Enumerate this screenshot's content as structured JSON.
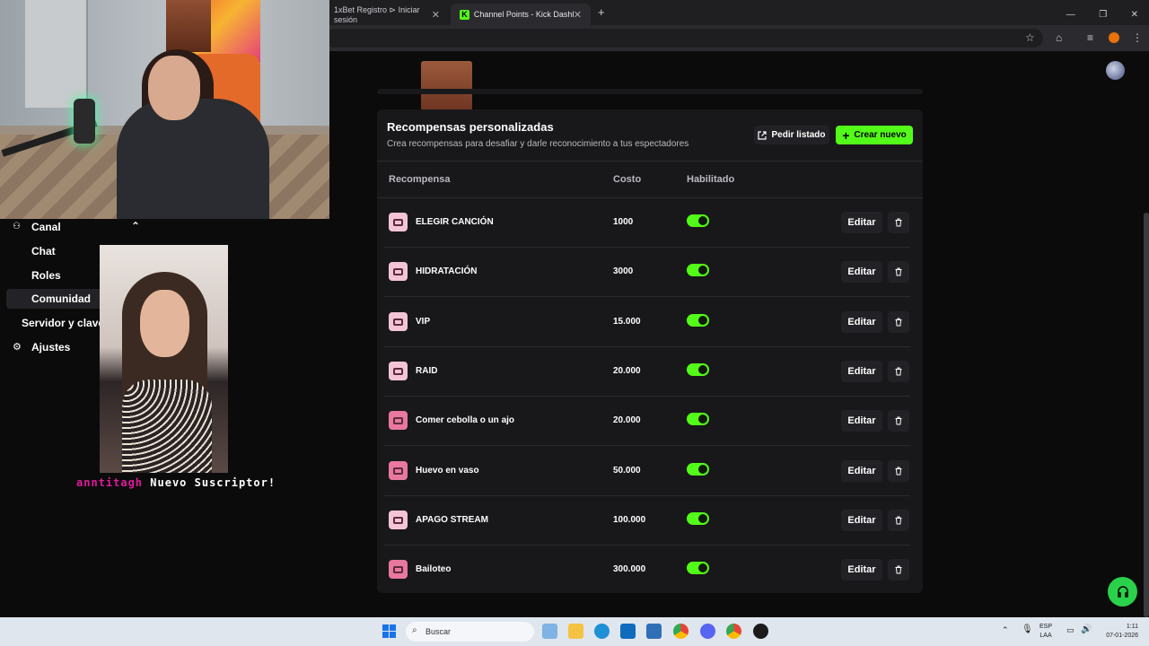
{
  "browser": {
    "tabs": [
      {
        "label": "1xBet Registro ⊳ Iniciar sesión",
        "active": false
      },
      {
        "label": "Channel Points - Kick Dashboard",
        "active": true
      }
    ],
    "new_tab_symbol": "+"
  },
  "sidebar": {
    "items": [
      {
        "label": "Canal",
        "icon": "channel-icon"
      },
      {
        "label": "Chat"
      },
      {
        "label": "Roles"
      },
      {
        "label": "Comunidad",
        "active": true
      },
      {
        "label": "Servidor y clave d"
      },
      {
        "label": "Ajustes",
        "icon": "gear-icon"
      }
    ]
  },
  "overlay": {
    "sub_user": "anntitagh",
    "sub_message": "Nuevo Suscriptor!"
  },
  "rewards": {
    "title": "Recompensas personalizadas",
    "subtitle": "Crea recompensas para desafiar y darle reconocimiento a tus espectadores",
    "btn_listado": "Pedir listado",
    "btn_nuevo": "Crear nuevo",
    "col_reward": "Recompensa",
    "col_cost": "Costo",
    "col_enabled": "Habilitado",
    "edit_label": "Editar",
    "items": [
      {
        "name": "ELEGIR CANCIÓN",
        "cost": "1000",
        "enabled": true,
        "icon_color": "light"
      },
      {
        "name": "HIDRATACIÓN",
        "cost": "3000",
        "enabled": true,
        "icon_color": "light"
      },
      {
        "name": "VIP",
        "cost": "15.000",
        "enabled": true,
        "icon_color": "light"
      },
      {
        "name": "RAID",
        "cost": "20.000",
        "enabled": true,
        "icon_color": "light"
      },
      {
        "name": "Comer cebolla o un ajo",
        "cost": "20.000",
        "enabled": true,
        "icon_color": "pink"
      },
      {
        "name": "Huevo en vaso",
        "cost": "50.000",
        "enabled": true,
        "icon_color": "pink"
      },
      {
        "name": "APAGO STREAM",
        "cost": "100.000",
        "enabled": true,
        "icon_color": "light"
      },
      {
        "name": "Bailoteo",
        "cost": "300.000",
        "enabled": true,
        "icon_color": "pink"
      }
    ]
  },
  "taskbar": {
    "search_placeholder": "Buscar",
    "lang_line1": "ESP",
    "lang_line2": "LAA",
    "time": "1:11",
    "date": "07-01-2026"
  },
  "colors": {
    "accent": "#53fc18",
    "panel": "#18181b",
    "page": "#0b0b0c"
  }
}
